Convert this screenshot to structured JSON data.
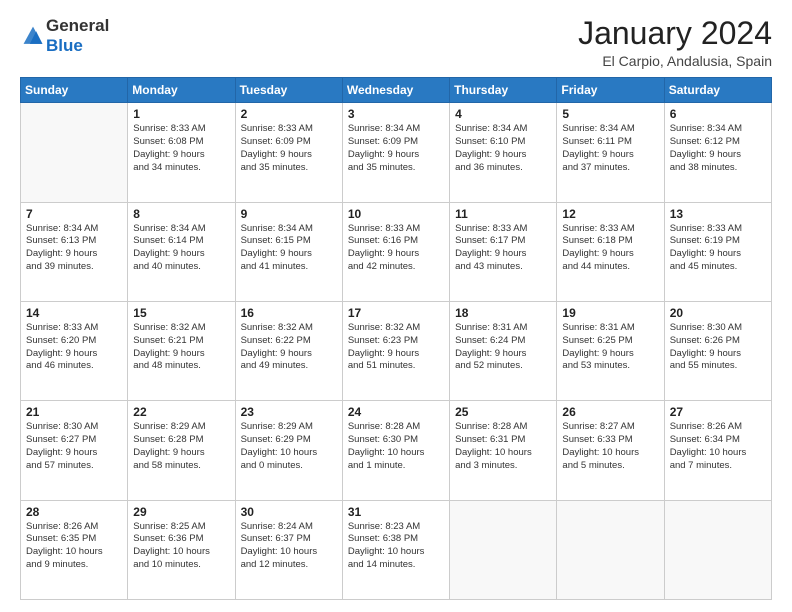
{
  "header": {
    "logo_general": "General",
    "logo_blue": "Blue",
    "month_title": "January 2024",
    "location": "El Carpio, Andalusia, Spain"
  },
  "days_of_week": [
    "Sunday",
    "Monday",
    "Tuesday",
    "Wednesday",
    "Thursday",
    "Friday",
    "Saturday"
  ],
  "weeks": [
    [
      {
        "num": "",
        "info": ""
      },
      {
        "num": "1",
        "info": "Sunrise: 8:33 AM\nSunset: 6:08 PM\nDaylight: 9 hours\nand 34 minutes."
      },
      {
        "num": "2",
        "info": "Sunrise: 8:33 AM\nSunset: 6:09 PM\nDaylight: 9 hours\nand 35 minutes."
      },
      {
        "num": "3",
        "info": "Sunrise: 8:34 AM\nSunset: 6:09 PM\nDaylight: 9 hours\nand 35 minutes."
      },
      {
        "num": "4",
        "info": "Sunrise: 8:34 AM\nSunset: 6:10 PM\nDaylight: 9 hours\nand 36 minutes."
      },
      {
        "num": "5",
        "info": "Sunrise: 8:34 AM\nSunset: 6:11 PM\nDaylight: 9 hours\nand 37 minutes."
      },
      {
        "num": "6",
        "info": "Sunrise: 8:34 AM\nSunset: 6:12 PM\nDaylight: 9 hours\nand 38 minutes."
      }
    ],
    [
      {
        "num": "7",
        "info": "Sunrise: 8:34 AM\nSunset: 6:13 PM\nDaylight: 9 hours\nand 39 minutes."
      },
      {
        "num": "8",
        "info": "Sunrise: 8:34 AM\nSunset: 6:14 PM\nDaylight: 9 hours\nand 40 minutes."
      },
      {
        "num": "9",
        "info": "Sunrise: 8:34 AM\nSunset: 6:15 PM\nDaylight: 9 hours\nand 41 minutes."
      },
      {
        "num": "10",
        "info": "Sunrise: 8:33 AM\nSunset: 6:16 PM\nDaylight: 9 hours\nand 42 minutes."
      },
      {
        "num": "11",
        "info": "Sunrise: 8:33 AM\nSunset: 6:17 PM\nDaylight: 9 hours\nand 43 minutes."
      },
      {
        "num": "12",
        "info": "Sunrise: 8:33 AM\nSunset: 6:18 PM\nDaylight: 9 hours\nand 44 minutes."
      },
      {
        "num": "13",
        "info": "Sunrise: 8:33 AM\nSunset: 6:19 PM\nDaylight: 9 hours\nand 45 minutes."
      }
    ],
    [
      {
        "num": "14",
        "info": "Sunrise: 8:33 AM\nSunset: 6:20 PM\nDaylight: 9 hours\nand 46 minutes."
      },
      {
        "num": "15",
        "info": "Sunrise: 8:32 AM\nSunset: 6:21 PM\nDaylight: 9 hours\nand 48 minutes."
      },
      {
        "num": "16",
        "info": "Sunrise: 8:32 AM\nSunset: 6:22 PM\nDaylight: 9 hours\nand 49 minutes."
      },
      {
        "num": "17",
        "info": "Sunrise: 8:32 AM\nSunset: 6:23 PM\nDaylight: 9 hours\nand 51 minutes."
      },
      {
        "num": "18",
        "info": "Sunrise: 8:31 AM\nSunset: 6:24 PM\nDaylight: 9 hours\nand 52 minutes."
      },
      {
        "num": "19",
        "info": "Sunrise: 8:31 AM\nSunset: 6:25 PM\nDaylight: 9 hours\nand 53 minutes."
      },
      {
        "num": "20",
        "info": "Sunrise: 8:30 AM\nSunset: 6:26 PM\nDaylight: 9 hours\nand 55 minutes."
      }
    ],
    [
      {
        "num": "21",
        "info": "Sunrise: 8:30 AM\nSunset: 6:27 PM\nDaylight: 9 hours\nand 57 minutes."
      },
      {
        "num": "22",
        "info": "Sunrise: 8:29 AM\nSunset: 6:28 PM\nDaylight: 9 hours\nand 58 minutes."
      },
      {
        "num": "23",
        "info": "Sunrise: 8:29 AM\nSunset: 6:29 PM\nDaylight: 10 hours\nand 0 minutes."
      },
      {
        "num": "24",
        "info": "Sunrise: 8:28 AM\nSunset: 6:30 PM\nDaylight: 10 hours\nand 1 minute."
      },
      {
        "num": "25",
        "info": "Sunrise: 8:28 AM\nSunset: 6:31 PM\nDaylight: 10 hours\nand 3 minutes."
      },
      {
        "num": "26",
        "info": "Sunrise: 8:27 AM\nSunset: 6:33 PM\nDaylight: 10 hours\nand 5 minutes."
      },
      {
        "num": "27",
        "info": "Sunrise: 8:26 AM\nSunset: 6:34 PM\nDaylight: 10 hours\nand 7 minutes."
      }
    ],
    [
      {
        "num": "28",
        "info": "Sunrise: 8:26 AM\nSunset: 6:35 PM\nDaylight: 10 hours\nand 9 minutes."
      },
      {
        "num": "29",
        "info": "Sunrise: 8:25 AM\nSunset: 6:36 PM\nDaylight: 10 hours\nand 10 minutes."
      },
      {
        "num": "30",
        "info": "Sunrise: 8:24 AM\nSunset: 6:37 PM\nDaylight: 10 hours\nand 12 minutes."
      },
      {
        "num": "31",
        "info": "Sunrise: 8:23 AM\nSunset: 6:38 PM\nDaylight: 10 hours\nand 14 minutes."
      },
      {
        "num": "",
        "info": ""
      },
      {
        "num": "",
        "info": ""
      },
      {
        "num": "",
        "info": ""
      }
    ]
  ]
}
